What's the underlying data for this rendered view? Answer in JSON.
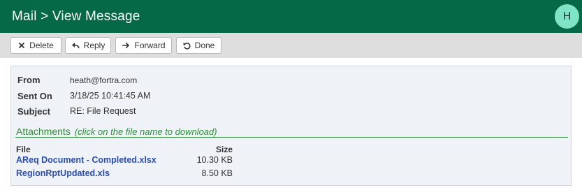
{
  "header": {
    "title": "Mail > View Message",
    "avatar_initial": "H",
    "background": "#056847",
    "avatar_color": "#7fe3c6"
  },
  "toolbar": {
    "delete_label": "Delete",
    "reply_label": "Reply",
    "forward_label": "Forward",
    "done_label": "Done"
  },
  "message": {
    "from_label": "From",
    "from_value": "heath@fortra.com",
    "sent_label": "Sent On",
    "sent_value": "3/18/25 10:41:45 AM",
    "subject_label": "Subject",
    "subject_value": "RE: File Request"
  },
  "attachments": {
    "title": "Attachments",
    "hint": "(click on the file name to download)",
    "col_file": "File",
    "col_size": "Size",
    "files": [
      {
        "name": "AReq Document - Completed.xlsx",
        "size": "10.30 KB"
      },
      {
        "name": "RegionRptUpdated.xls",
        "size": "8.50 KB"
      }
    ],
    "accent": "#2e8b3a",
    "link_color": "#2b4db0"
  }
}
